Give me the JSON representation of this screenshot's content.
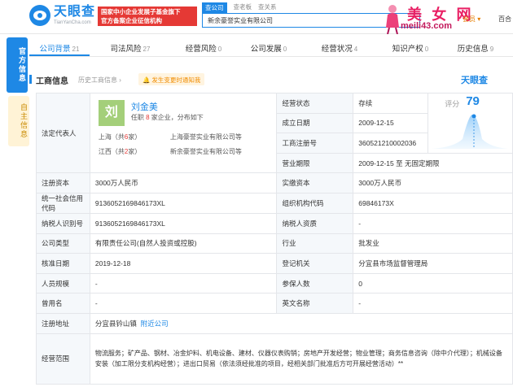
{
  "header": {
    "logo_cn": "天眼查",
    "logo_en": "TianYanCha.com",
    "banner_line1": "国家中小企业发展子基金旗下",
    "banner_line2": "官方备案企业征信机构",
    "search_tabs": [
      "查公司",
      "查老板",
      "查关系"
    ],
    "search_value": "新余豪誉实业有限公司",
    "watermark_title": "美 女 网",
    "watermark_url": "meili43.com",
    "vip_label": "会员 ▾",
    "baiqi_label": "百合"
  },
  "side_tabs": {
    "official": "官方信息",
    "self": "自主信息"
  },
  "category_tabs": [
    {
      "label": "公司背景",
      "count": "21"
    },
    {
      "label": "司法风险",
      "count": "27"
    },
    {
      "label": "经营风险",
      "count": "0"
    },
    {
      "label": "公司发展",
      "count": "0"
    },
    {
      "label": "经营状况",
      "count": "4"
    },
    {
      "label": "知识产权",
      "count": "0"
    },
    {
      "label": "历史信息",
      "count": "9"
    }
  ],
  "section": {
    "title": "工商信息",
    "history": "历史工商信息 ›",
    "notice": "🔔 发生变更时通知我",
    "brand": "天眼查"
  },
  "legal_rep": {
    "label": "法定代表人",
    "avatar": "刘",
    "name": "刘金美",
    "desc_prefix": "任职",
    "desc_count": "8",
    "desc_suffix": "家企业，分布如下",
    "regions": [
      {
        "region": "上海（共",
        "count": "6",
        "tail": "家）",
        "company": "上海豪誉实业有限公司等"
      },
      {
        "region": "江西（共",
        "count": "2",
        "tail": "家）",
        "company": "新余豪誉实业有限公司等"
      }
    ]
  },
  "right_top": [
    {
      "key": "经营状态",
      "value": "存续"
    },
    {
      "key": "成立日期",
      "value": "2009-12-15"
    },
    {
      "key": "工商注册号",
      "value": "360521210002036"
    },
    {
      "key": "营业期限",
      "value": "2009-12-15 至 无固定期限"
    }
  ],
  "score": {
    "label": "评分",
    "value": "79"
  },
  "rows": [
    {
      "k1": "注册资本",
      "v1": "3000万人民币",
      "k2": "实缴资本",
      "v2": "3000万人民币"
    },
    {
      "k1": "统一社会信用代码",
      "v1": "913605216984617​3XL",
      "k2": "组织机构代码",
      "v2": "69846173X"
    },
    {
      "k1": "纳税人识别号",
      "v1": "9136052169846173XL",
      "k2": "纳税人资质",
      "v2": "-"
    },
    {
      "k1": "公司类型",
      "v1": "有限责任公司(自然人投资或控股)",
      "k2": "行业",
      "v2": "批发业"
    },
    {
      "k1": "核准日期",
      "v1": "2019-12-18",
      "k2": "登记机关",
      "v2": "分宜县市场监督管理局"
    },
    {
      "k1": "人员规模",
      "v1": "-",
      "k2": "参保人数",
      "v2": "0"
    },
    {
      "k1": "曾用名",
      "v1": "-",
      "k2": "英文名称",
      "v2": "-"
    }
  ],
  "address": {
    "key": "注册地址",
    "value": "分宜县钤山镇",
    "link": "附近公司"
  },
  "scope": {
    "key": "经营范围",
    "value": "物流服务；矿产品、钢材、冶金炉料、机电设备、建材、仪器仪表购销；房地产开发经营；物业管理；商务信息咨询（除中介代理）；机械设备安装（加工限分支机构经营）；进出口贸易（依法须经批准的项目，经相关部门批准后方可开展经营活动）**"
  }
}
